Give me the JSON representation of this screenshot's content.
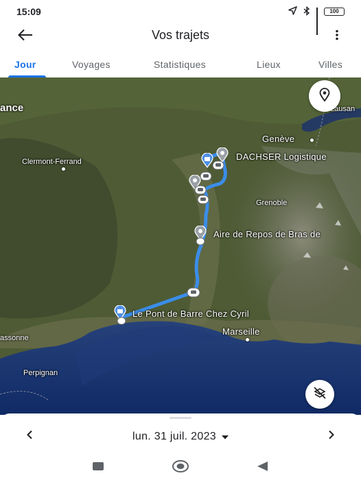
{
  "status": {
    "time": "15:09",
    "battery_label": "100"
  },
  "header": {
    "title": "Vos trajets"
  },
  "tabs": [
    {
      "label": "Jour",
      "active": true
    },
    {
      "label": "Voyages",
      "active": false
    },
    {
      "label": "Statistiques",
      "active": false
    },
    {
      "label": "Lieux",
      "active": false
    },
    {
      "label": "Villes",
      "active": false
    }
  ],
  "map": {
    "labels": {
      "france": "ance",
      "clermont": "Clermont-Ferrand",
      "geneve": "Genève",
      "lausanne": "Lausan",
      "grenoble": "Grenoble",
      "marseille": "Marseille",
      "carcassonne": "assonne",
      "perpignan": "Perpignan"
    },
    "places": {
      "dachser": "DACHSER Logistique",
      "aire": "Aire de Repos de Bras de",
      "pont": "Le Pont de Barre Chez Cyril"
    },
    "route_color": "#3b8de8"
  },
  "footer": {
    "date": "lun. 31 juil. 2023"
  },
  "colors": {
    "accent": "#1a73e8",
    "text": "#202124",
    "muted": "#5f6368"
  }
}
